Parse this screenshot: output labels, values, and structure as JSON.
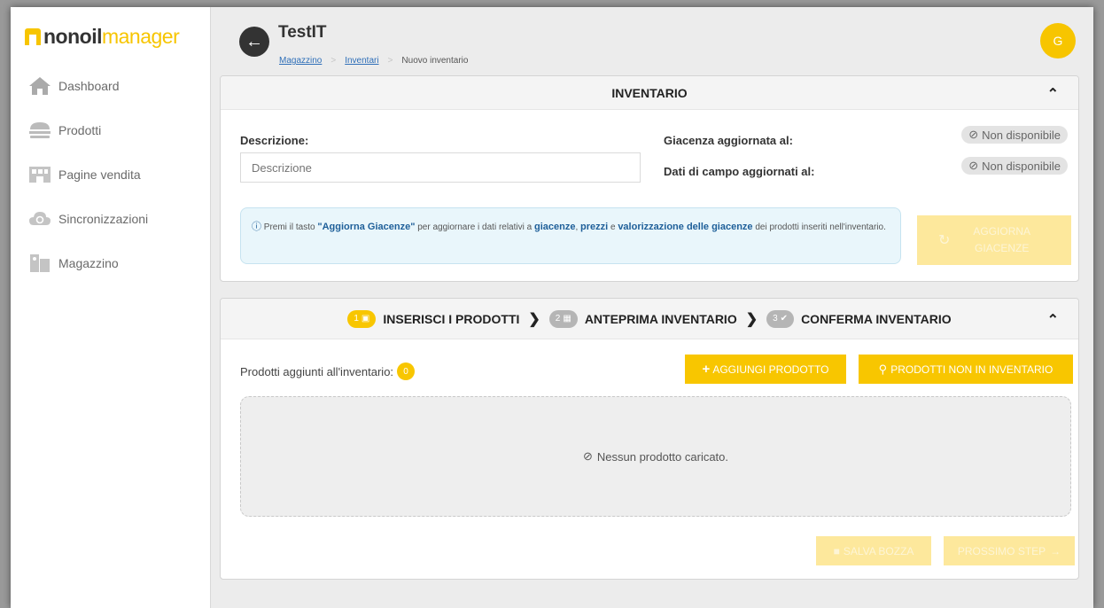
{
  "sidebar": {
    "logo": {
      "part1": "nonoil",
      "part2": "manager"
    },
    "items": [
      {
        "label": "Dashboard",
        "icon": "home-icon"
      },
      {
        "label": "Prodotti",
        "icon": "burger-icon"
      },
      {
        "label": "Pagine vendita",
        "icon": "shop-icon"
      },
      {
        "label": "Sincronizzazioni",
        "icon": "cloud-sync-icon"
      },
      {
        "label": "Magazzino",
        "icon": "warehouse-icon"
      }
    ]
  },
  "header": {
    "title": "TestIT",
    "breadcrumb": [
      "Magazzino",
      "Inventari",
      "Nuovo inventario"
    ],
    "avatar_initial": "G"
  },
  "inventario": {
    "heading": "INVENTARIO",
    "descrizione_label": "Descrizione:",
    "descrizione_placeholder": "Descrizione",
    "giacenza_label": "Giacenza aggiornata al:",
    "giacenza_value": "Non disponibile",
    "dati_label": "Dati di campo aggiornati al:",
    "dati_value": "Non disponibile",
    "info": {
      "t1": "Premi il tasto ",
      "b1": "\"Aggiorna Giacenze\"",
      "t2": " per aggiornare i dati relativi a ",
      "b2": "giacenze",
      "t3": ", ",
      "b3": "prezzi",
      "t4": " e ",
      "b4": "valorizzazione delle giacenze",
      "t5": " dei prodotti inseriti nell'inventario."
    },
    "aggiorna_button": "AGGIORNA GIACENZE"
  },
  "wizard": {
    "steps": [
      {
        "num": "1",
        "label": "INSERISCI I PRODOTTI",
        "active": true
      },
      {
        "num": "2",
        "label": "ANTEPRIMA INVENTARIO",
        "active": false
      },
      {
        "num": "3",
        "label": "CONFERMA INVENTARIO",
        "active": false
      }
    ],
    "products_label": "Prodotti aggiunti all'inventario:",
    "products_count": "0",
    "add_button": "AGGIUNGI PRODOTTO",
    "not_in_inventory_button": "PRODOTTI NON IN INVENTARIO",
    "empty_message": "Nessun prodotto caricato.",
    "save_draft_button": "SALVA BOZZA",
    "next_step_button": "PROSSIMO STEP"
  },
  "colors": {
    "accent": "#f8c600",
    "dark": "#333333",
    "link": "#2f6fb8",
    "info_bg": "#e9f6fb"
  }
}
